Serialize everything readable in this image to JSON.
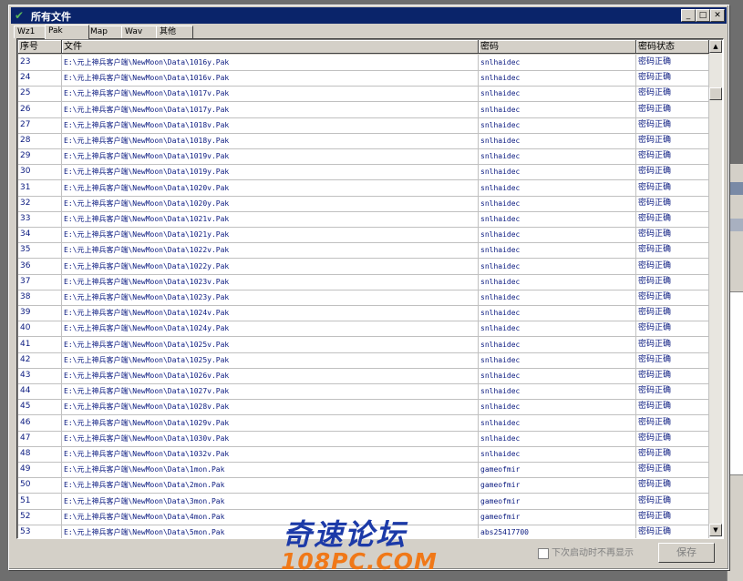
{
  "window": {
    "title": "所有文件"
  },
  "tabs": [
    "Wz1",
    "Pak",
    "Map",
    "Wav",
    "其他"
  ],
  "columns": {
    "no": "序号",
    "file": "文件",
    "password": "密码",
    "status": "密码状态"
  },
  "rows": [
    {
      "no": "23",
      "file": "E:\\元上神兵客户端\\NewMoon\\Data\\1016y.Pak",
      "password": "snlhaidec",
      "status": "密码正确"
    },
    {
      "no": "24",
      "file": "E:\\元上神兵客户端\\NewMoon\\Data\\1016v.Pak",
      "password": "snlhaidec",
      "status": "密码正确"
    },
    {
      "no": "25",
      "file": "E:\\元上神兵客户端\\NewMoon\\Data\\1017v.Pak",
      "password": "snlhaidec",
      "status": "密码正确"
    },
    {
      "no": "26",
      "file": "E:\\元上神兵客户端\\NewMoon\\Data\\1017y.Pak",
      "password": "snlhaidec",
      "status": "密码正确"
    },
    {
      "no": "27",
      "file": "E:\\元上神兵客户端\\NewMoon\\Data\\1018v.Pak",
      "password": "snlhaidec",
      "status": "密码正确"
    },
    {
      "no": "28",
      "file": "E:\\元上神兵客户端\\NewMoon\\Data\\1018y.Pak",
      "password": "snlhaidec",
      "status": "密码正确"
    },
    {
      "no": "29",
      "file": "E:\\元上神兵客户端\\NewMoon\\Data\\1019v.Pak",
      "password": "snlhaidec",
      "status": "密码正确"
    },
    {
      "no": "30",
      "file": "E:\\元上神兵客户端\\NewMoon\\Data\\1019y.Pak",
      "password": "snlhaidec",
      "status": "密码正确"
    },
    {
      "no": "31",
      "file": "E:\\元上神兵客户端\\NewMoon\\Data\\1020v.Pak",
      "password": "snlhaidec",
      "status": "密码正确"
    },
    {
      "no": "32",
      "file": "E:\\元上神兵客户端\\NewMoon\\Data\\1020y.Pak",
      "password": "snlhaidec",
      "status": "密码正确"
    },
    {
      "no": "33",
      "file": "E:\\元上神兵客户端\\NewMoon\\Data\\1021v.Pak",
      "password": "snlhaidec",
      "status": "密码正确"
    },
    {
      "no": "34",
      "file": "E:\\元上神兵客户端\\NewMoon\\Data\\1021y.Pak",
      "password": "snlhaidec",
      "status": "密码正确"
    },
    {
      "no": "35",
      "file": "E:\\元上神兵客户端\\NewMoon\\Data\\1022v.Pak",
      "password": "snlhaidec",
      "status": "密码正确"
    },
    {
      "no": "36",
      "file": "E:\\元上神兵客户端\\NewMoon\\Data\\1022y.Pak",
      "password": "snlhaidec",
      "status": "密码正确"
    },
    {
      "no": "37",
      "file": "E:\\元上神兵客户端\\NewMoon\\Data\\1023v.Pak",
      "password": "snlhaidec",
      "status": "密码正确"
    },
    {
      "no": "38",
      "file": "E:\\元上神兵客户端\\NewMoon\\Data\\1023y.Pak",
      "password": "snlhaidec",
      "status": "密码正确"
    },
    {
      "no": "39",
      "file": "E:\\元上神兵客户端\\NewMoon\\Data\\1024v.Pak",
      "password": "snlhaidec",
      "status": "密码正确"
    },
    {
      "no": "40",
      "file": "E:\\元上神兵客户端\\NewMoon\\Data\\1024y.Pak",
      "password": "snlhaidec",
      "status": "密码正确"
    },
    {
      "no": "41",
      "file": "E:\\元上神兵客户端\\NewMoon\\Data\\1025v.Pak",
      "password": "snlhaidec",
      "status": "密码正确"
    },
    {
      "no": "42",
      "file": "E:\\元上神兵客户端\\NewMoon\\Data\\1025y.Pak",
      "password": "snlhaidec",
      "status": "密码正确"
    },
    {
      "no": "43",
      "file": "E:\\元上神兵客户端\\NewMoon\\Data\\1026v.Pak",
      "password": "snlhaidec",
      "status": "密码正确"
    },
    {
      "no": "44",
      "file": "E:\\元上神兵客户端\\NewMoon\\Data\\1027v.Pak",
      "password": "snlhaidec",
      "status": "密码正确"
    },
    {
      "no": "45",
      "file": "E:\\元上神兵客户端\\NewMoon\\Data\\1028v.Pak",
      "password": "snlhaidec",
      "status": "密码正确"
    },
    {
      "no": "46",
      "file": "E:\\元上神兵客户端\\NewMoon\\Data\\1029v.Pak",
      "password": "snlhaidec",
      "status": "密码正确"
    },
    {
      "no": "47",
      "file": "E:\\元上神兵客户端\\NewMoon\\Data\\1030v.Pak",
      "password": "snlhaidec",
      "status": "密码正确"
    },
    {
      "no": "48",
      "file": "E:\\元上神兵客户端\\NewMoon\\Data\\1032v.Pak",
      "password": "snlhaidec",
      "status": "密码正确"
    },
    {
      "no": "49",
      "file": "E:\\元上神兵客户端\\NewMoon\\Data\\1mon.Pak",
      "password": "gameofmir",
      "status": "密码正确"
    },
    {
      "no": "50",
      "file": "E:\\元上神兵客户端\\NewMoon\\Data\\2mon.Pak",
      "password": "gameofmir",
      "status": "密码正确"
    },
    {
      "no": "51",
      "file": "E:\\元上神兵客户端\\NewMoon\\Data\\3mon.Pak",
      "password": "gameofmir",
      "status": "密码正确"
    },
    {
      "no": "52",
      "file": "E:\\元上神兵客户端\\NewMoon\\Data\\4mon.Pak",
      "password": "gameofmir",
      "status": "密码正确"
    },
    {
      "no": "53",
      "file": "E:\\元上神兵客户端\\NewMoon\\Data\\5mon.Pak",
      "password": "abs25417700",
      "status": "密码正确"
    }
  ],
  "footer": {
    "checkbox_label": "下次启动时不再显示",
    "save_label": "保存"
  },
  "watermark": {
    "cn": "奇速论坛",
    "en": "108PC.COM"
  },
  "colors": {
    "titlebar": "#0a246a",
    "row_text": "#0a1a80"
  }
}
